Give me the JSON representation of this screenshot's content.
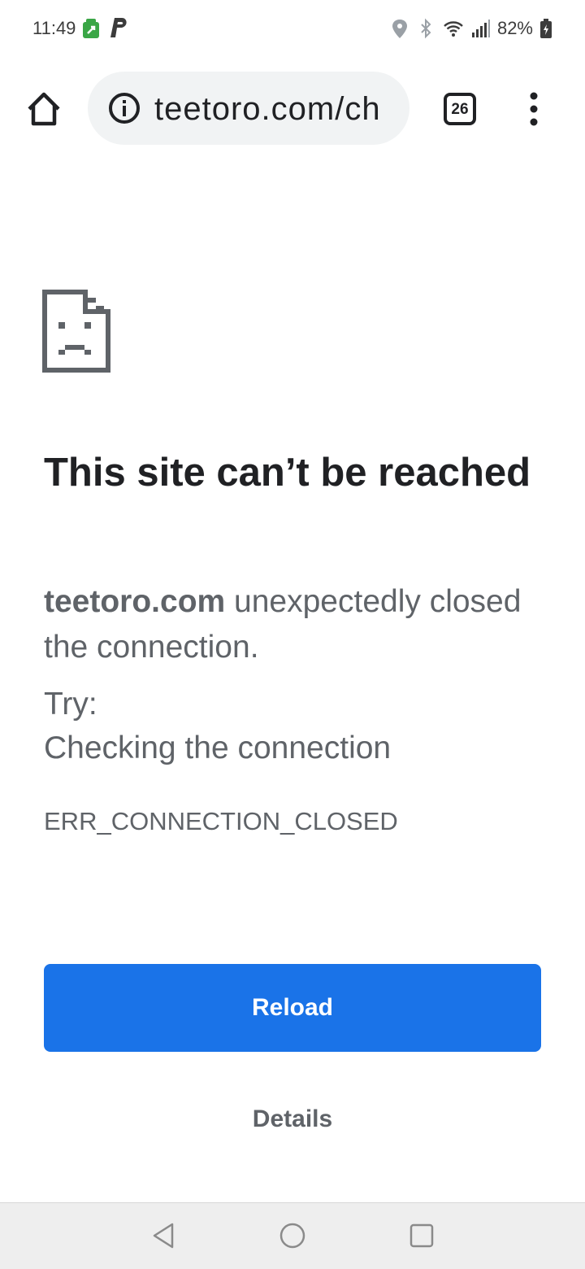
{
  "status_bar": {
    "time": "11:49",
    "battery_percent": "82%"
  },
  "toolbar": {
    "url": "teetoro.com/ch",
    "tab_count": "26"
  },
  "error": {
    "title": "This site can’t be reached",
    "domain": "teetoro.com",
    "description": " unexpectedly closed the connection.",
    "try_label": "Try:",
    "suggestion": "Checking the connection",
    "code": "ERR_CONNECTION_CLOSED"
  },
  "actions": {
    "reload_label": "Reload",
    "details_label": "Details"
  },
  "colors": {
    "accent": "#1a73e8",
    "text_primary": "#202124",
    "text_secondary": "#5f6368",
    "omnibox_bg": "#f1f3f4",
    "navbar_bg": "#eeeeee"
  }
}
